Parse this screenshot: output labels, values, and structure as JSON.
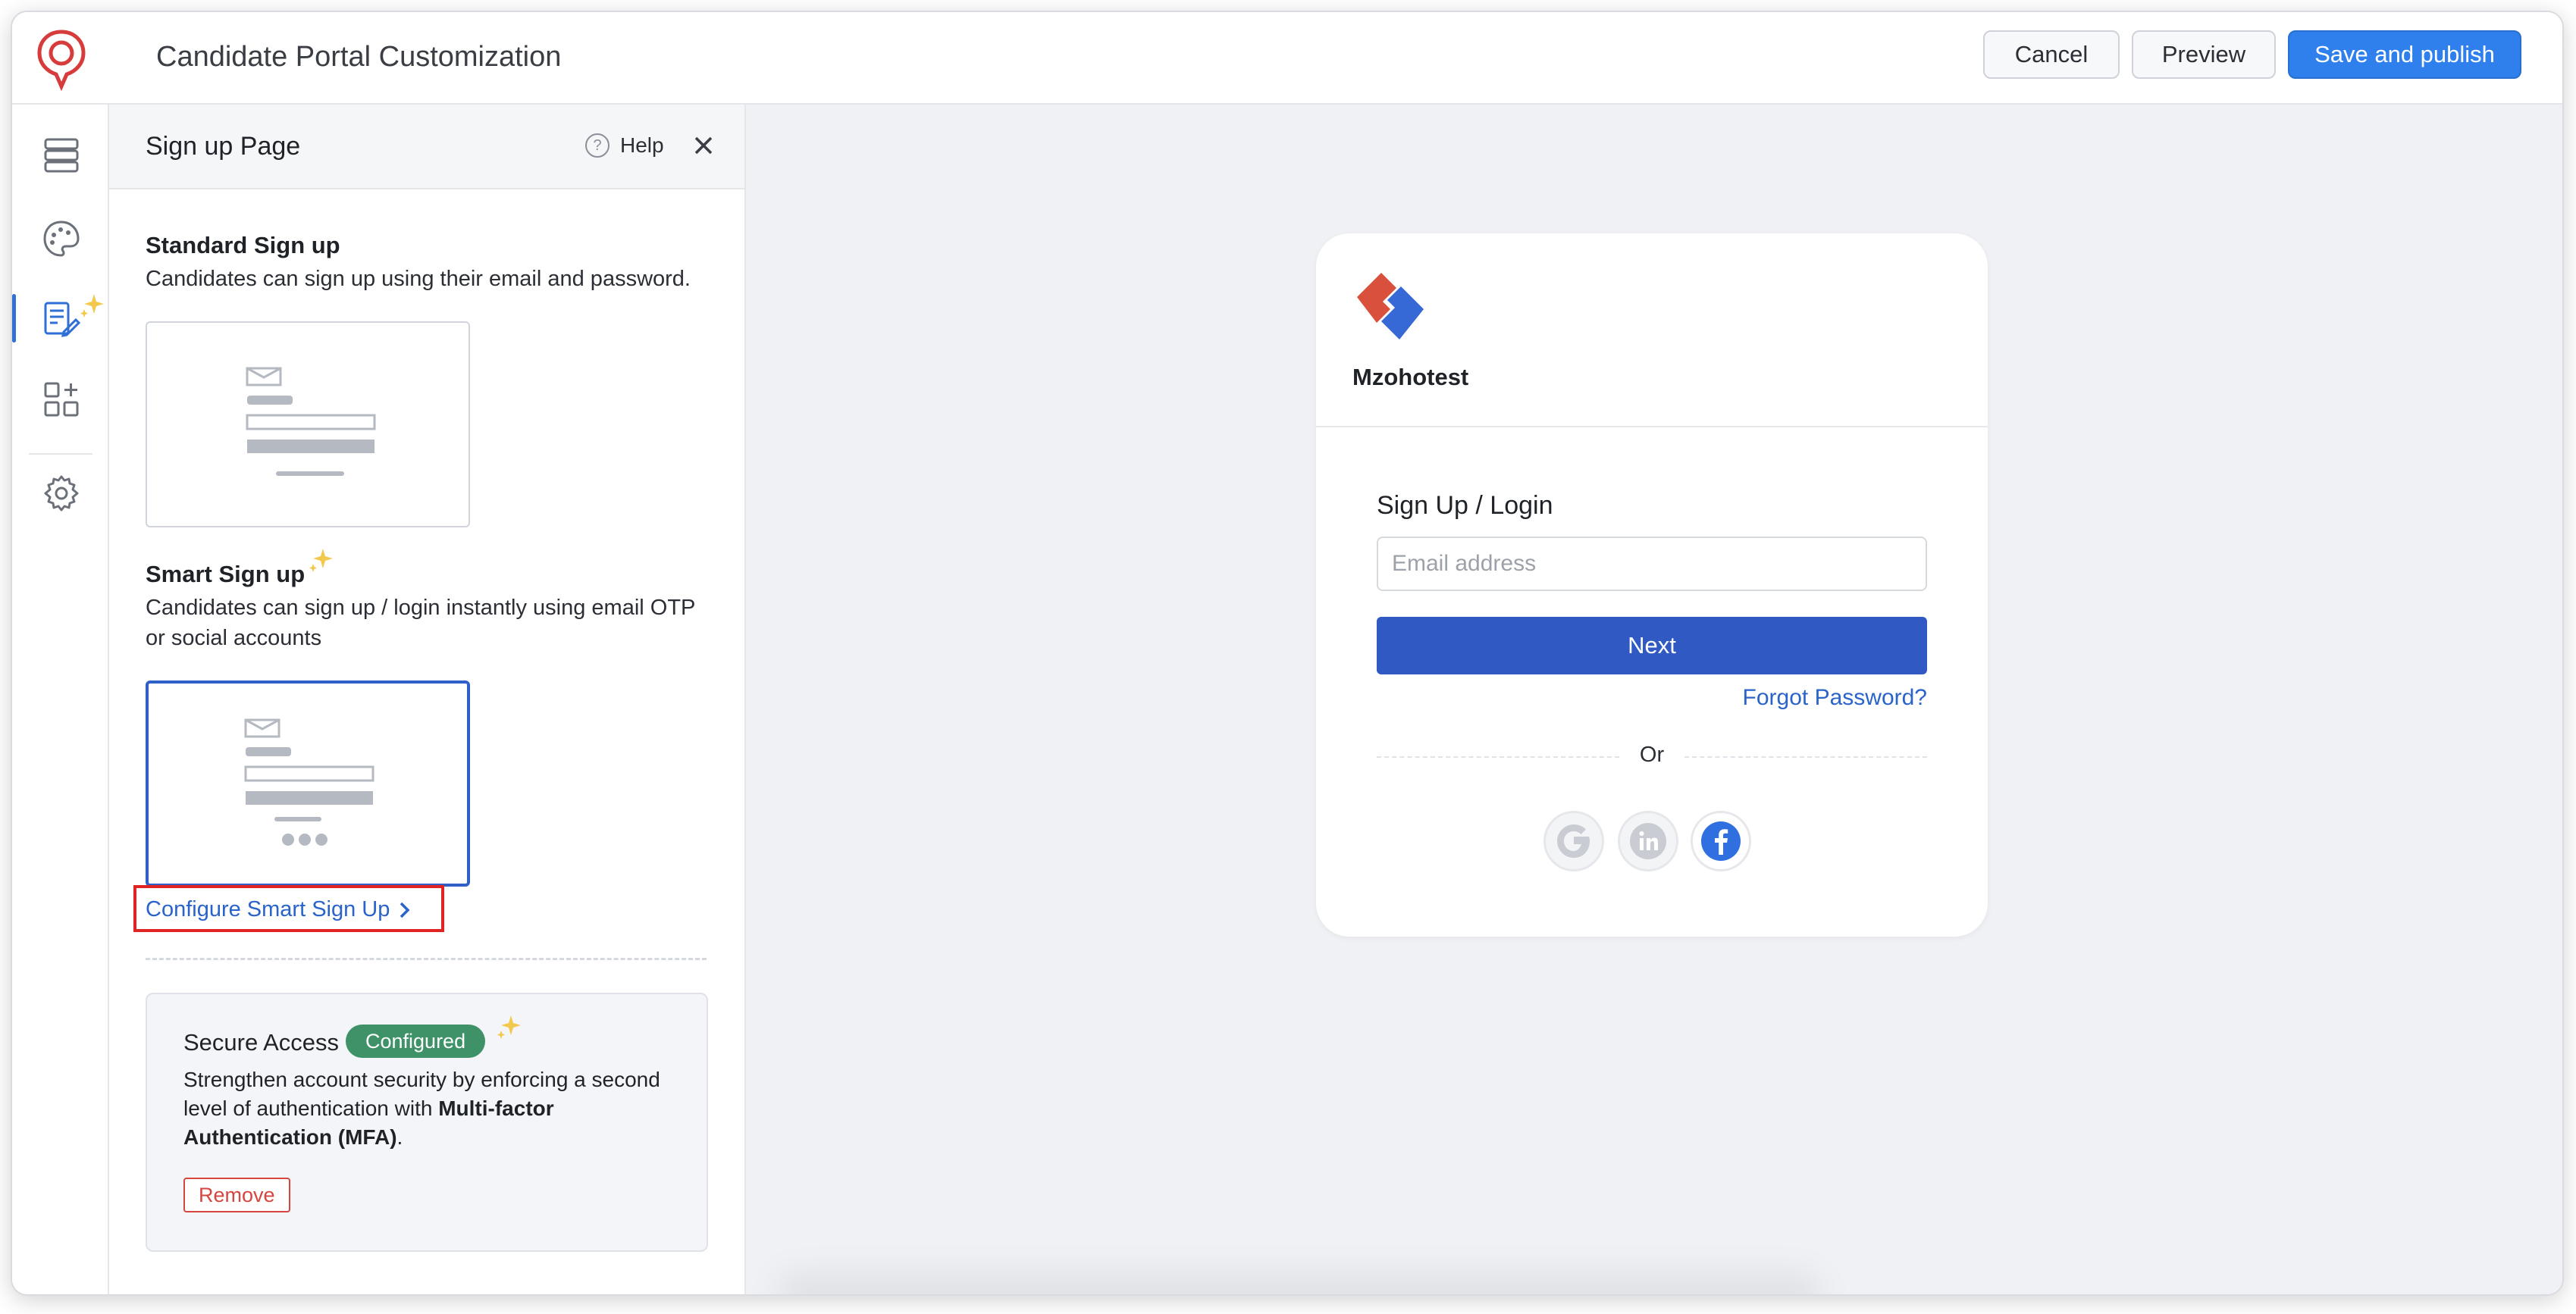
{
  "header": {
    "title": "Candidate Portal Customization",
    "cancel_label": "Cancel",
    "preview_label": "Preview",
    "save_label": "Save and publish"
  },
  "rail": {
    "items": [
      "layout-icon",
      "palette-icon",
      "form-edit-icon",
      "widgets-add-icon",
      "gear-icon"
    ],
    "active_index": 2
  },
  "panel": {
    "title": "Sign up Page",
    "help_label": "Help",
    "help_glyph": "?",
    "standard": {
      "title": "Standard Sign up",
      "description": "Candidates can sign up using their email and password."
    },
    "smart": {
      "title": "Smart Sign up",
      "description": "Candidates can sign up / login instantly using email OTP or social accounts",
      "configure_link": "Configure Smart Sign Up"
    },
    "secure": {
      "title": "Secure Access",
      "badge": "Configured",
      "desc_part1": "Strengthen account security by enforcing a second level of authentication with ",
      "desc_bold": "Multi-factor Authentication (MFA)",
      "desc_part2": ".",
      "remove_label": "Remove"
    }
  },
  "preview": {
    "brand_name": "Mzohotest",
    "login_title": "Sign Up / Login",
    "email_placeholder": "Email address",
    "next_label": "Next",
    "forgot_label": "Forgot Password?",
    "or_label": "Or",
    "social": [
      "google-icon",
      "linkedin-icon",
      "facebook-icon"
    ]
  },
  "colors": {
    "primary": "#2f80ed",
    "next_button": "#3059c4",
    "link": "#2a63c9",
    "badge": "#3f9168",
    "remove": "#d64540",
    "highlight_box": "#e02424",
    "sparkle": "#f2c94c"
  }
}
